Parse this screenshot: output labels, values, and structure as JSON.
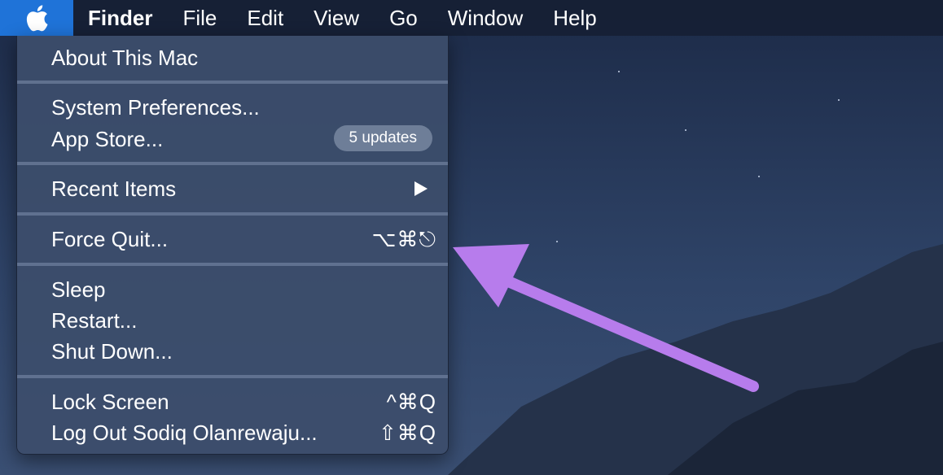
{
  "menubar": {
    "apple_icon": "apple-logo-icon",
    "items": [
      {
        "label": "Finder"
      },
      {
        "label": "File"
      },
      {
        "label": "Edit"
      },
      {
        "label": "View"
      },
      {
        "label": "Go"
      },
      {
        "label": "Window"
      },
      {
        "label": "Help"
      }
    ],
    "active_color": "#1f73d8"
  },
  "apple_menu": {
    "about": "About This Mac",
    "system_prefs": "System Preferences...",
    "app_store": "App Store...",
    "app_store_badge": "5 updates",
    "recent_items": "Recent Items",
    "recent_items_icon": "submenu-arrow-icon",
    "force_quit": "Force Quit...",
    "force_quit_shortcut": "⌥⌘⎋",
    "sleep": "Sleep",
    "restart": "Restart...",
    "shut_down": "Shut Down...",
    "lock_screen": "Lock Screen",
    "lock_screen_shortcut": "^⌘Q",
    "log_out": "Log Out Sodiq Olanrewaju...",
    "log_out_shortcut": "⇧⌘Q"
  },
  "annotation": {
    "arrow_color": "#b77cec"
  }
}
